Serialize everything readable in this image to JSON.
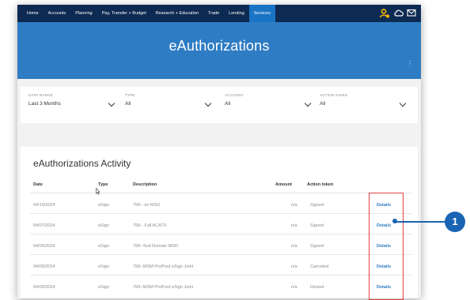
{
  "nav": {
    "items": [
      "Home",
      "Accounts",
      "Planning",
      "Pay, Transfer + Budget",
      "Research + Education",
      "Trade",
      "Lending",
      "Services"
    ],
    "active_index": 7
  },
  "page": {
    "title": "eAuthorizations"
  },
  "filters": [
    {
      "label": "DATE RANGE",
      "value": "Last 3 Months"
    },
    {
      "label": "TYPE",
      "value": "All"
    },
    {
      "label": "ACCOUNT",
      "value": "All"
    },
    {
      "label": "ACTION TAKEN",
      "value": "All"
    }
  ],
  "activity": {
    "heading": "eAuthorizations Activity",
    "columns": {
      "date": "Date",
      "type": "Type",
      "description": "Description",
      "amount": "Amount",
      "action": "Action token"
    },
    "rows": [
      {
        "date": "04/10/2024",
        "type": "eSign",
        "description": "799-- on MSO",
        "amount": "n/a",
        "action": "Signed",
        "details": "Details"
      },
      {
        "date": "04/07/2024",
        "type": "eSign",
        "description": "799-- Full ACATS",
        "amount": "n/a",
        "action": "Signed",
        "details": "Details"
      },
      {
        "date": "04/05/2024",
        "type": "eSign",
        "description": "799--Sub Domain MSO",
        "amount": "n/a",
        "action": "Signed",
        "details": "Details"
      },
      {
        "date": "04/05/2024",
        "type": "eSign",
        "description": "799--MSM ProProd eSign Joint",
        "amount": "n/a",
        "action": "Canceled",
        "details": "Details"
      },
      {
        "date": "04/05/2024",
        "type": "eSign",
        "description": "799--MSM ProProd eSign Joint",
        "amount": "n/a",
        "action": "Denied",
        "details": "Details"
      }
    ]
  },
  "callout": {
    "number": "1"
  },
  "colors": {
    "nav": "#0d2a52",
    "hero": "#2e7cc4",
    "accent": "#2e7cc4",
    "highlight": "#e34141",
    "callout": "#1a64b4"
  },
  "icons": [
    "user-alert-icon",
    "cloud-icon",
    "mail-icon",
    "chevron-down-icon",
    "kebab-icon",
    "cursor-icon"
  ]
}
